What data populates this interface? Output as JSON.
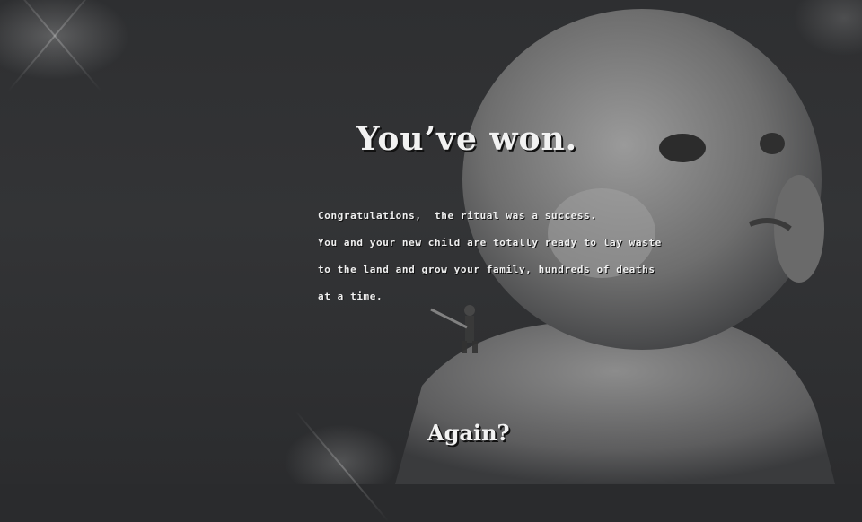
{
  "title": "You’ve won.",
  "message_lines": [
    "Congratulations,  the ritual was a success.",
    "You and your new child are totally ready to lay waste",
    "to the land and grow your family, hundreds of deaths",
    "at a time."
  ],
  "again_label": "Again?",
  "colors": {
    "background": "#2a2b2d",
    "text": "#f2f2f2"
  }
}
